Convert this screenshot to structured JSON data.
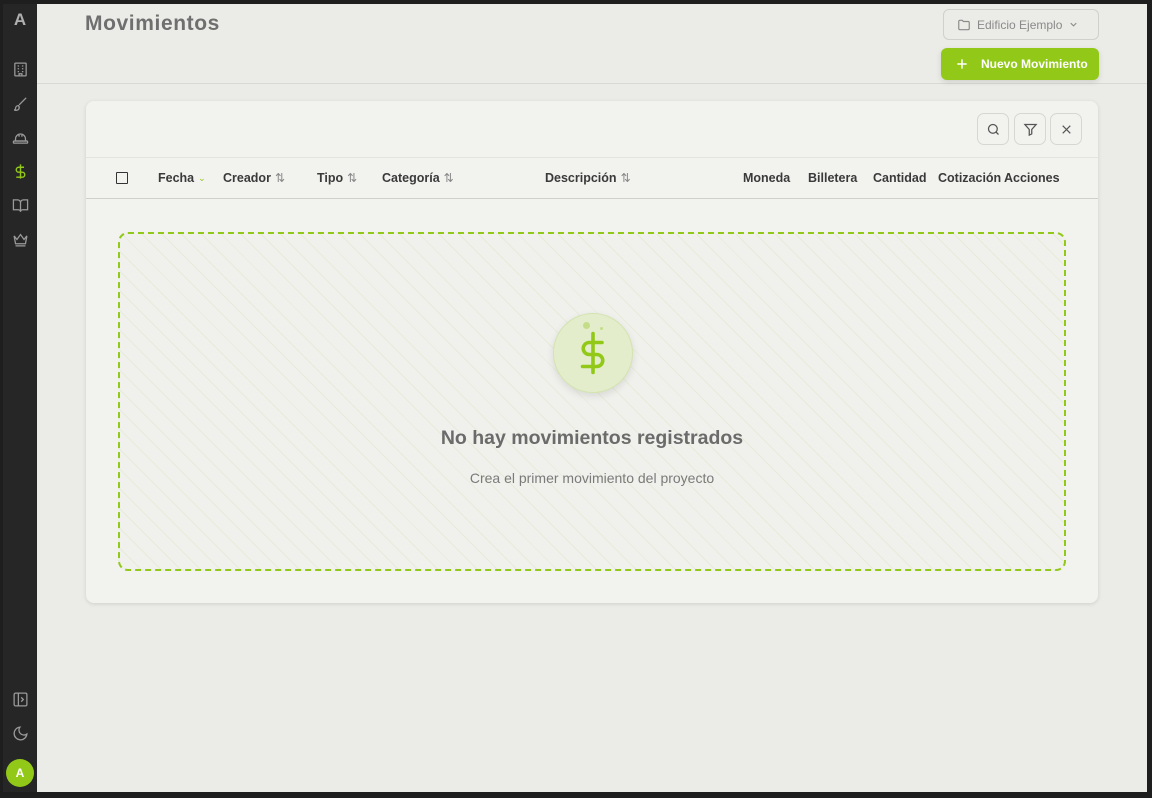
{
  "sidebar": {
    "logo": "A",
    "nav": [
      {
        "icon": "building-icon"
      },
      {
        "icon": "brush-icon"
      },
      {
        "icon": "helmet-icon"
      },
      {
        "icon": "dollar-icon",
        "active": true
      },
      {
        "icon": "book-icon"
      },
      {
        "icon": "crown-icon"
      }
    ],
    "bottom": [
      {
        "icon": "panel-toggle-icon"
      },
      {
        "icon": "moon-icon"
      }
    ],
    "avatar": "A"
  },
  "header": {
    "title": "Movimientos",
    "project_select": "Edificio Ejemplo",
    "new_button": "Nuevo Movimiento"
  },
  "table": {
    "columns": [
      "Fecha",
      "Creador",
      "Tipo",
      "Categoría",
      "Descripción",
      "Moneda",
      "Billetera",
      "Cantidad",
      "Cotización",
      "Acciones"
    ]
  },
  "empty_state": {
    "title": "No hay movimientos registrados",
    "subtitle": "Crea el primer movimiento del proyecto"
  },
  "colors": {
    "accent": "#92c919",
    "sidebar_bg": "#262626",
    "main_bg": "#ebebe7",
    "card_bg": "#f2f2ef"
  }
}
